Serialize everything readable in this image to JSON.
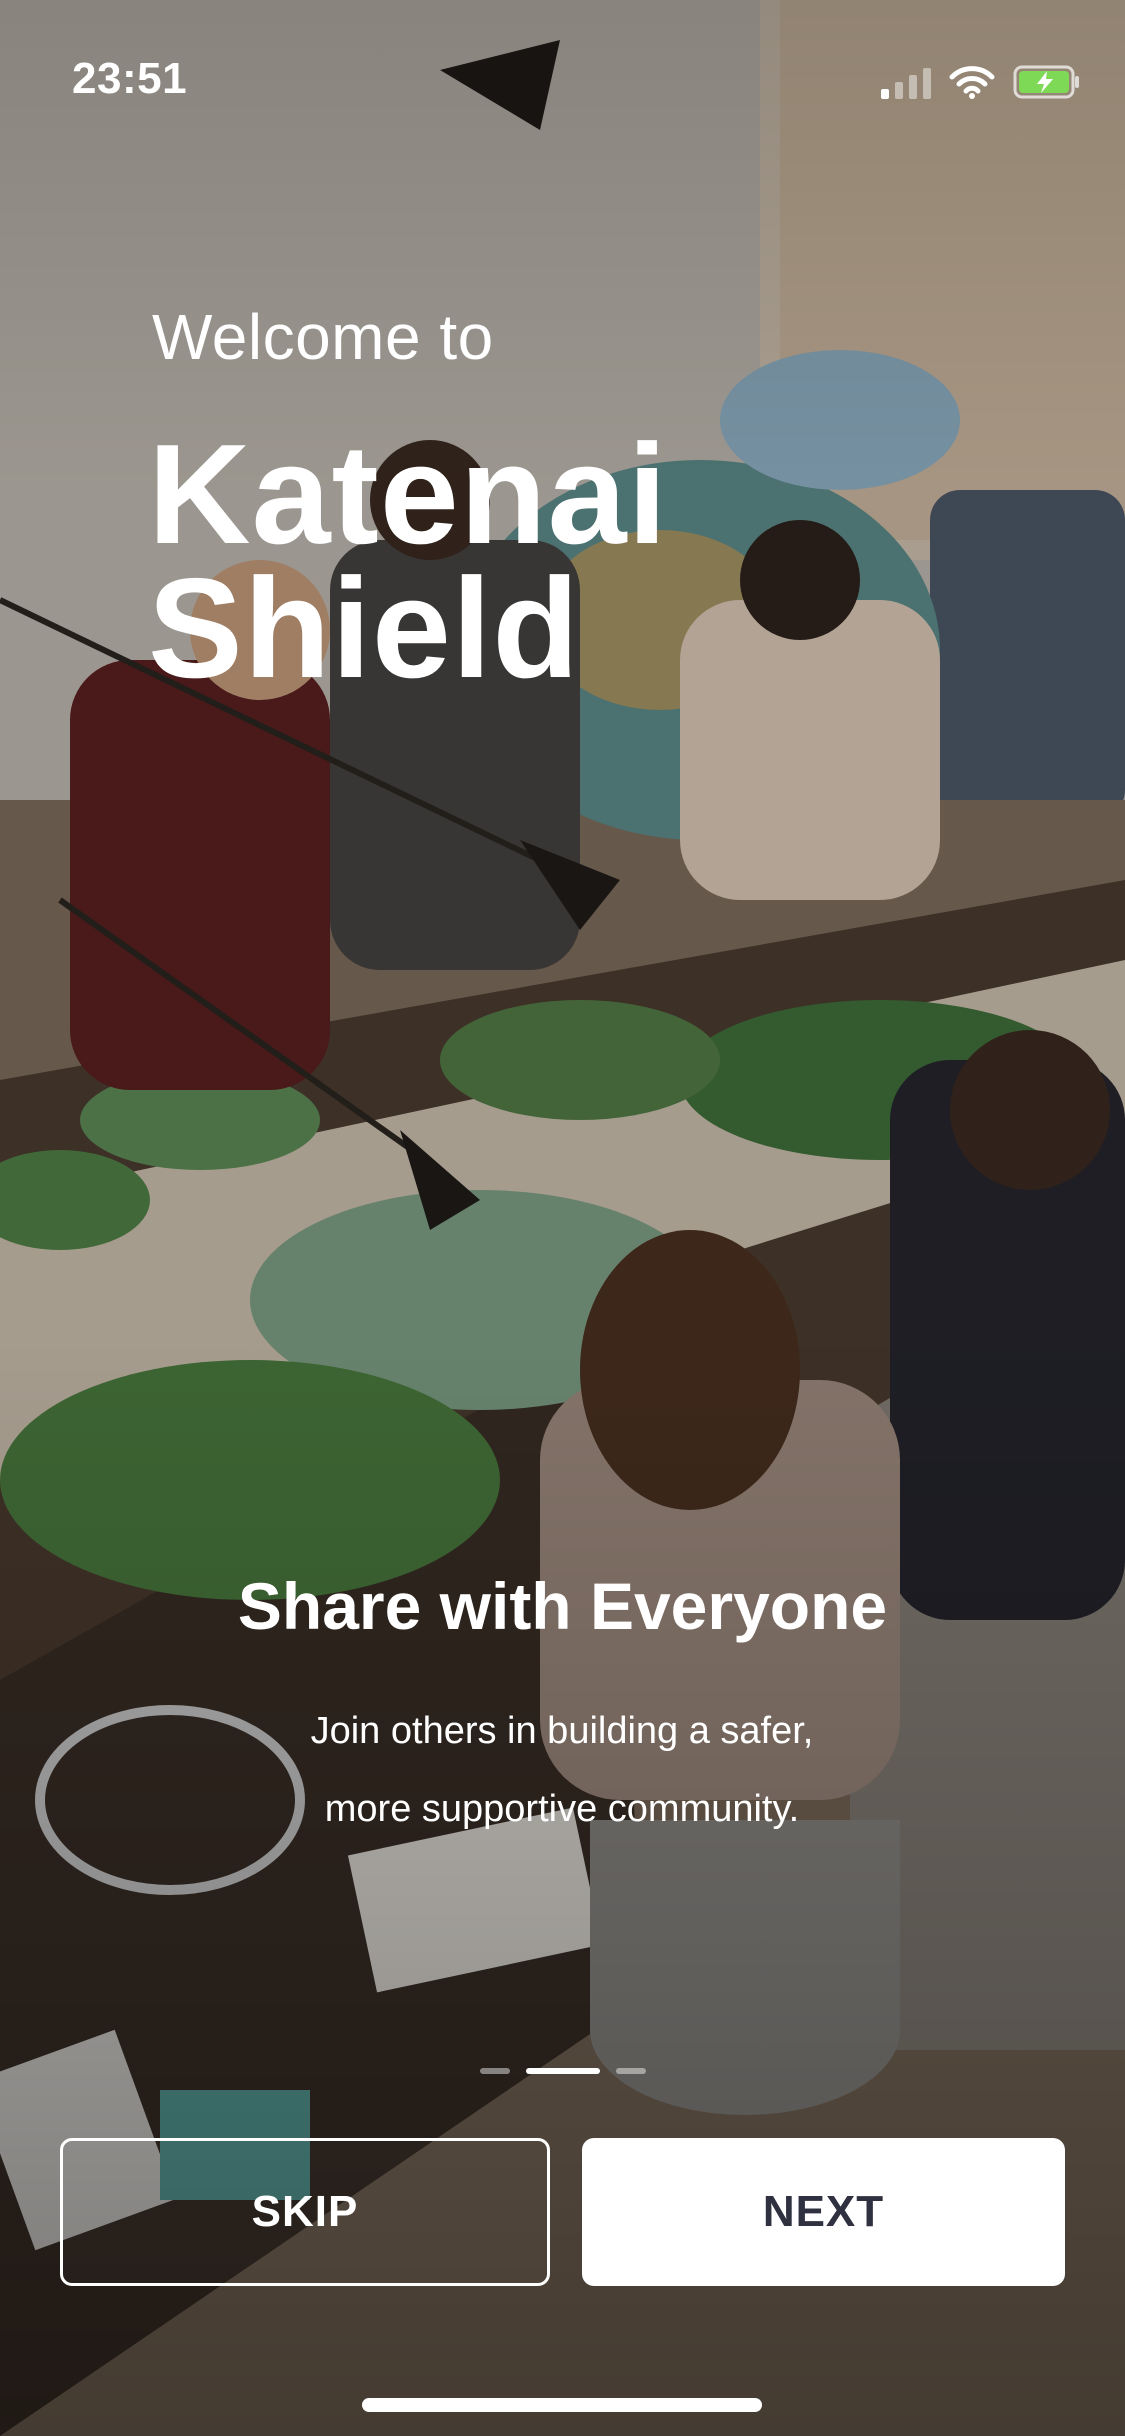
{
  "status_bar": {
    "time": "23:51",
    "icons": [
      "cellular-signal-icon",
      "wifi-icon",
      "battery-charging-icon"
    ]
  },
  "header": {
    "welcome": "Welcome to",
    "brand_line1": "Katenai",
    "brand_line2": "Shield"
  },
  "slide": {
    "title": "Share with Everyone",
    "description_line1": "Join others in building a safer,",
    "description_line2": "more supportive community."
  },
  "pager": {
    "total": 3,
    "active_index": 1
  },
  "buttons": {
    "skip_label": "SKIP",
    "next_label": "NEXT"
  },
  "colors": {
    "next_text": "#2f3040",
    "button_bg": "#ffffff",
    "battery_charging": "#7ed957"
  }
}
